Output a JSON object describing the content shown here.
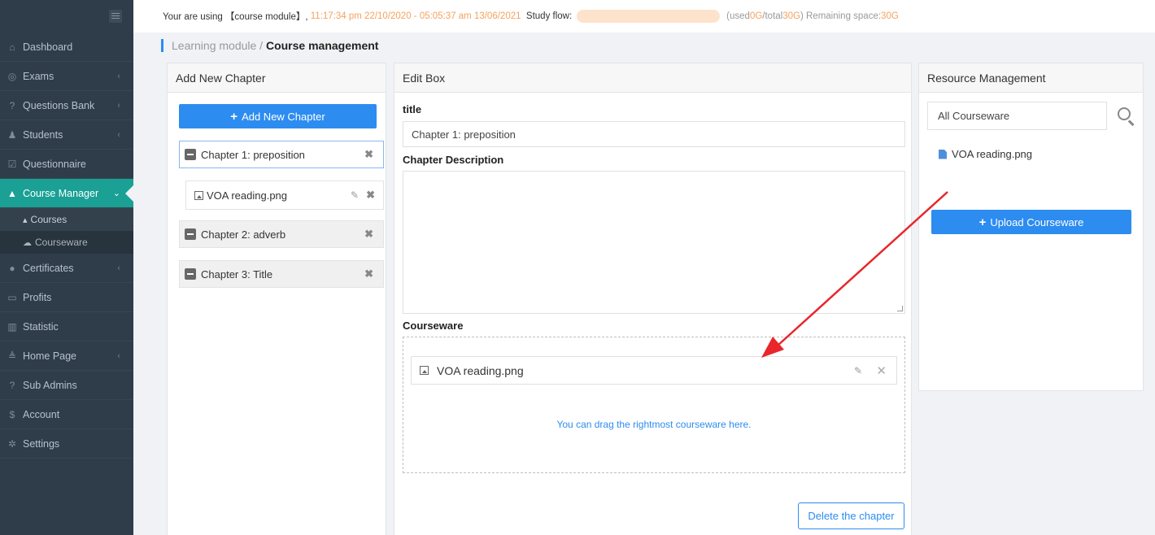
{
  "sidebar": {
    "items": [
      {
        "label": "Dashboard",
        "icon": "home-icon",
        "glyph": "⌂",
        "chevron": ""
      },
      {
        "label": "Exams",
        "icon": "check-circle-icon",
        "glyph": "◎",
        "chevron": "‹"
      },
      {
        "label": "Questions Bank",
        "icon": "question-circle-icon",
        "glyph": "?",
        "chevron": "‹"
      },
      {
        "label": "Students",
        "icon": "user-group-icon",
        "glyph": "♟",
        "chevron": "‹"
      },
      {
        "label": "Questionnaire",
        "icon": "checkbox-icon",
        "glyph": "☑",
        "chevron": ""
      },
      {
        "label": "Course Manager",
        "icon": "graduation-cap-icon",
        "glyph": "▲",
        "chevron": "⌄"
      }
    ],
    "sub_items": [
      {
        "label": "Courses",
        "icon": "graduation-cap-icon",
        "glyph": "▴"
      },
      {
        "label": "Courseware",
        "icon": "cloud-icon",
        "glyph": "☁"
      }
    ],
    "items_after": [
      {
        "label": "Certificates",
        "icon": "circle-icon",
        "glyph": "●",
        "chevron": "‹"
      },
      {
        "label": "Profits",
        "icon": "card-icon",
        "glyph": "▭",
        "chevron": ""
      },
      {
        "label": "Statistic",
        "icon": "bar-chart-icon",
        "glyph": "▥",
        "chevron": ""
      },
      {
        "label": "Home Page",
        "icon": "layers-icon",
        "glyph": "≜",
        "chevron": "‹"
      },
      {
        "label": "Sub Admins",
        "icon": "question-circle-icon",
        "glyph": "?",
        "chevron": ""
      },
      {
        "label": "Account",
        "icon": "dollar-icon",
        "glyph": "$",
        "chevron": ""
      },
      {
        "label": "Settings",
        "icon": "gear-icon",
        "glyph": "✲",
        "chevron": ""
      }
    ]
  },
  "topbar": {
    "prefix": "Your are using 【course module】,",
    "time_range": "11:17:34 pm 22/10/2020 - 05:05:37 am 13/06/2021",
    "flow_label": "Study flow:",
    "used_prefix": "(used ",
    "used_value": "0G",
    "total_prefix": "/total ",
    "total_value": "30G",
    "remaining_prefix": ") Remaining space: ",
    "remaining_value": "30G"
  },
  "breadcrumb": {
    "parent": "Learning module / ",
    "current": "Course management"
  },
  "chapters_panel": {
    "title": "Add New Chapter",
    "add_button": "Add New Chapter",
    "chapters": [
      {
        "title": "Chapter 1: preposition"
      },
      {
        "title": "Chapter 2: adverb"
      },
      {
        "title": "Chapter 3: Title"
      }
    ],
    "chapter1_file": "VOA reading.png"
  },
  "edit_box": {
    "title": "Edit Box",
    "title_label": "title",
    "title_value": "Chapter 1: preposition",
    "description_label": "Chapter Description",
    "courseware_label": "Courseware",
    "courseware_file": "VOA reading.png",
    "drag_hint": "You can drag the rightmost courseware here.",
    "delete_button": "Delete the chapter"
  },
  "resource_panel": {
    "title": "Resource Management",
    "search_value": "All Courseware",
    "file": "VOA reading.png",
    "upload_button": "Upload Courseware"
  },
  "colors": {
    "accent": "#2d8cf0",
    "sidebar_bg": "#2f3d4a",
    "sidebar_active": "#1aa094",
    "highlight": "#f5a25d",
    "annotation_arrow": "#e8262b"
  }
}
